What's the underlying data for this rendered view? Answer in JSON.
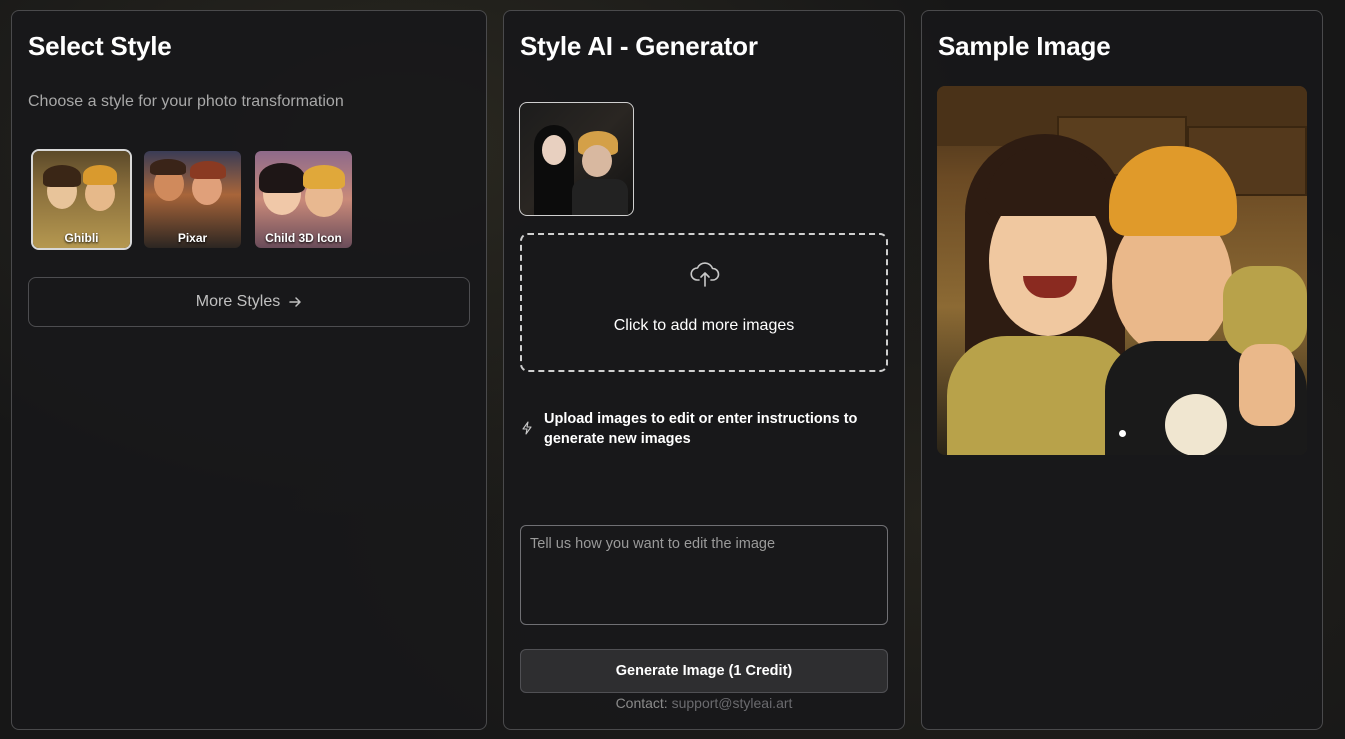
{
  "select_style": {
    "title": "Select Style",
    "subtitle": "Choose a style for your photo transformation",
    "styles": [
      {
        "label": "Ghibli",
        "selected": true
      },
      {
        "label": "Pixar",
        "selected": false
      },
      {
        "label": "Child 3D Icon",
        "selected": false
      }
    ],
    "more_label": "More Styles"
  },
  "generator": {
    "title": "Style AI - Generator",
    "dropzone_text": "Click to add more images",
    "hint_line1": "Upload images to edit or enter instructions to",
    "hint_line2": "generate new images",
    "prompt_placeholder": "Tell us how you want to edit the image",
    "prompt_value": "",
    "generate_label": "Generate Image (1 Credit)",
    "contact_label": "Contact:",
    "contact_email": "support@styleai.art"
  },
  "sample": {
    "title": "Sample Image"
  },
  "colors": {
    "panel_border": "#4a4a4c",
    "accent_text": "#ffffff",
    "muted_text": "#a8a8a8"
  }
}
